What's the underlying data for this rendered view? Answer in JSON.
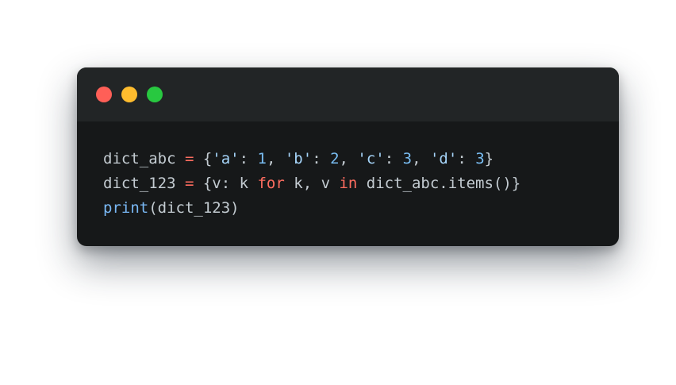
{
  "window": {
    "controls": [
      {
        "name": "close",
        "color": "#ff5f57"
      },
      {
        "name": "minimize",
        "color": "#febc2e"
      },
      {
        "name": "maximize",
        "color": "#28c840"
      }
    ]
  },
  "colors": {
    "plain": "#c3cbd1",
    "operator": "#ff6d60",
    "keyword": "#ff6d60",
    "string": "#a6d5fa",
    "number": "#79bdf2",
    "builtin": "#79b8f5"
  },
  "code": {
    "lines": [
      [
        {
          "t": "dict_abc ",
          "k": "plain"
        },
        {
          "t": "=",
          "k": "operator"
        },
        {
          "t": " {",
          "k": "plain"
        },
        {
          "t": "'a'",
          "k": "string"
        },
        {
          "t": ": ",
          "k": "plain"
        },
        {
          "t": "1",
          "k": "number"
        },
        {
          "t": ", ",
          "k": "plain"
        },
        {
          "t": "'b'",
          "k": "string"
        },
        {
          "t": ": ",
          "k": "plain"
        },
        {
          "t": "2",
          "k": "number"
        },
        {
          "t": ", ",
          "k": "plain"
        },
        {
          "t": "'c'",
          "k": "string"
        },
        {
          "t": ": ",
          "k": "plain"
        },
        {
          "t": "3",
          "k": "number"
        },
        {
          "t": ", ",
          "k": "plain"
        },
        {
          "t": "'d'",
          "k": "string"
        },
        {
          "t": ": ",
          "k": "plain"
        },
        {
          "t": "3",
          "k": "number"
        },
        {
          "t": "}",
          "k": "plain"
        }
      ],
      [
        {
          "t": "dict_123 ",
          "k": "plain"
        },
        {
          "t": "=",
          "k": "operator"
        },
        {
          "t": " {v: k ",
          "k": "plain"
        },
        {
          "t": "for",
          "k": "keyword"
        },
        {
          "t": " k, v ",
          "k": "plain"
        },
        {
          "t": "in",
          "k": "keyword"
        },
        {
          "t": " dict_abc.items()}",
          "k": "plain"
        }
      ],
      [
        {
          "t": "print",
          "k": "builtin"
        },
        {
          "t": "(dict_123)",
          "k": "plain"
        }
      ]
    ]
  }
}
